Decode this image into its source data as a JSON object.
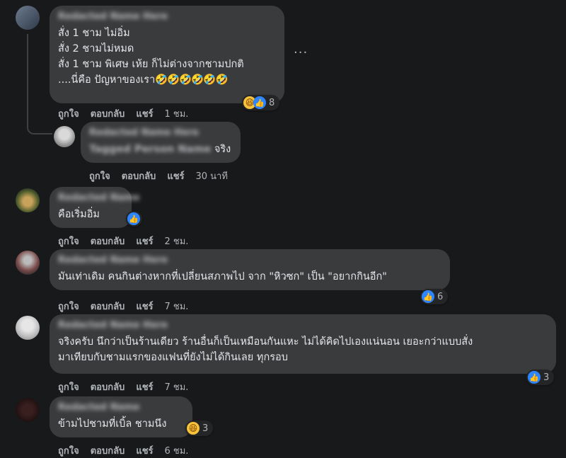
{
  "comments": [
    {
      "text": "สั่ง 1 ชาม ไม่อิ่ม\nสั่ง 2 ชามไม่หมด\nสั่ง 1 ชาม พิเศษ เห้ย ก็ไม่ต่างจากชามปกติ\n....นี่คือ ปัญหาของเรา",
      "emoji": "🤣🤣🤣🤣🤣🤣",
      "reaction_count": "8",
      "actions": {
        "like": "ถูกใจ",
        "reply": "ตอบกลับ",
        "share": "แชร์",
        "time": "1 ชม."
      }
    },
    {
      "text": "จริง",
      "actions": {
        "like": "ถูกใจ",
        "reply": "ตอบกลับ",
        "share": "แชร์",
        "time": "30 นาที"
      }
    },
    {
      "text": "คือเริ่มอิ่ม",
      "actions": {
        "like": "ถูกใจ",
        "reply": "ตอบกลับ",
        "share": "แชร์",
        "time": "2 ชม."
      }
    },
    {
      "text": "มันเท่าเดิม คนกินต่างหากที่เปลี่ยนสภาพไป จาก \"หิวซก\" เป็น \"อยากกินอีก\"",
      "reaction_count": "6",
      "actions": {
        "like": "ถูกใจ",
        "reply": "ตอบกลับ",
        "share": "แชร์",
        "time": "7 ชม."
      }
    },
    {
      "text": "จริงครับ นึกว่าเป็นร้านเดียว ร้านอื่นก็เป็นเหมือนกันแหะ ไม่ได้คิดไปเองแน่นอน เยอะกว่าแบบสั่ง\nมาเทียบกับชามแรกของแฟนที่ยังไม่ได้กินเลย ทุกรอบ",
      "reaction_count": "3",
      "actions": {
        "like": "ถูกใจ",
        "reply": "ตอบกลับ",
        "share": "แชร์",
        "time": "7 ชม."
      }
    },
    {
      "text": "ข้ามไปชามที่เบิ้ล ชามนึง",
      "reaction_count": "3",
      "actions": {
        "like": "ถูกใจ",
        "reply": "ตอบกลับ",
        "share": "แชร์",
        "time": "6 ชม."
      }
    }
  ],
  "icons": {
    "like": "like-icon",
    "haha": "haha-icon",
    "more": "more-options-icon"
  },
  "colors": {
    "background": "#18191a",
    "bubble": "#3a3b3c",
    "like": "#2d86ff",
    "haha": "#f7c33a",
    "meta": "#b0b3b8"
  }
}
